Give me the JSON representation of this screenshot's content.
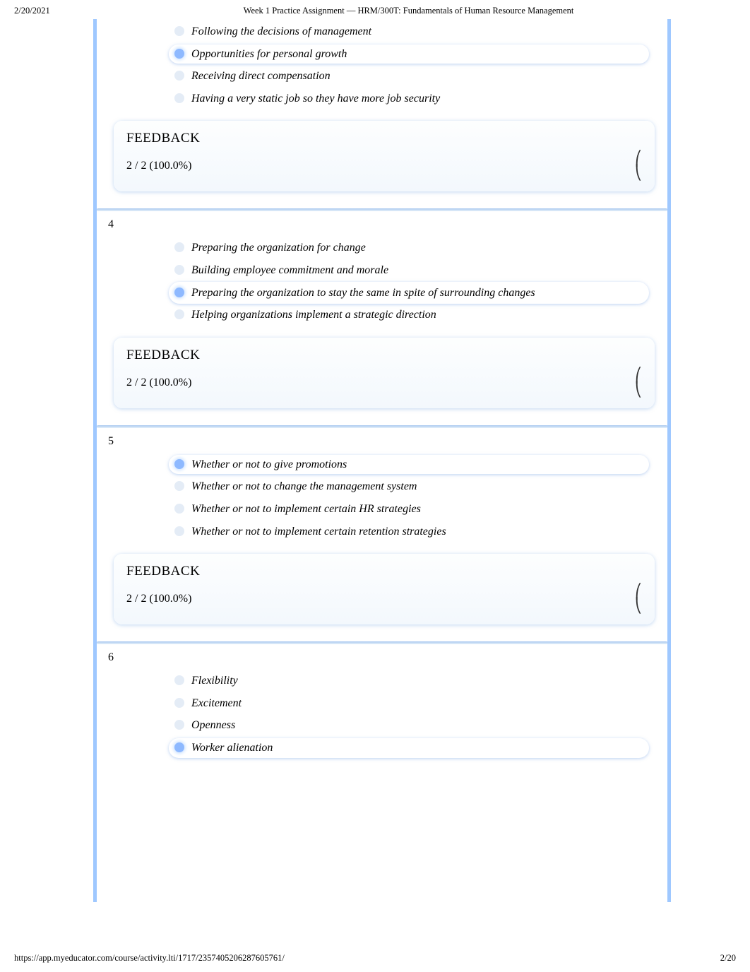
{
  "header": {
    "date": "2/20/2021",
    "title": "Week 1 Practice Assignment — HRM/300T: Fundamentals of Human Resource Management"
  },
  "questions": [
    {
      "number": "",
      "options": [
        {
          "text": "Following the decisions of management",
          "selected": false
        },
        {
          "text": "Opportunities for personal growth",
          "selected": true
        },
        {
          "text": "Receiving direct compensation",
          "selected": false
        },
        {
          "text": "Having a very static job so they have more job security",
          "selected": false
        }
      ],
      "feedback": {
        "label": "FEEDBACK",
        "score": "2 / 2 (100.0%)"
      }
    },
    {
      "number": "4",
      "options": [
        {
          "text": "Preparing the organization for change",
          "selected": false
        },
        {
          "text": "Building employee commitment and morale",
          "selected": false
        },
        {
          "text": "Preparing the organization to stay the same in spite of surrounding changes",
          "selected": true
        },
        {
          "text": "Helping organizations implement a strategic direction",
          "selected": false
        }
      ],
      "feedback": {
        "label": "FEEDBACK",
        "score": "2 / 2 (100.0%)"
      }
    },
    {
      "number": "5",
      "options": [
        {
          "text": "Whether or not to give promotions",
          "selected": true
        },
        {
          "text": "Whether or not to change the management system",
          "selected": false
        },
        {
          "text": "Whether or not to implement certain HR strategies",
          "selected": false
        },
        {
          "text": "Whether or not to implement certain retention strategies",
          "selected": false
        }
      ],
      "feedback": {
        "label": "FEEDBACK",
        "score": "2 / 2 (100.0%)"
      }
    },
    {
      "number": "6",
      "options": [
        {
          "text": "Flexibility",
          "selected": false
        },
        {
          "text": "Excitement",
          "selected": false
        },
        {
          "text": "Openness",
          "selected": false
        },
        {
          "text": "Worker alienation",
          "selected": true
        }
      ],
      "feedback": null
    }
  ],
  "footer": {
    "url": "https://app.myeducator.com/course/activity.lti/1717/2357405206287605761/",
    "pagenum": "2/20"
  }
}
